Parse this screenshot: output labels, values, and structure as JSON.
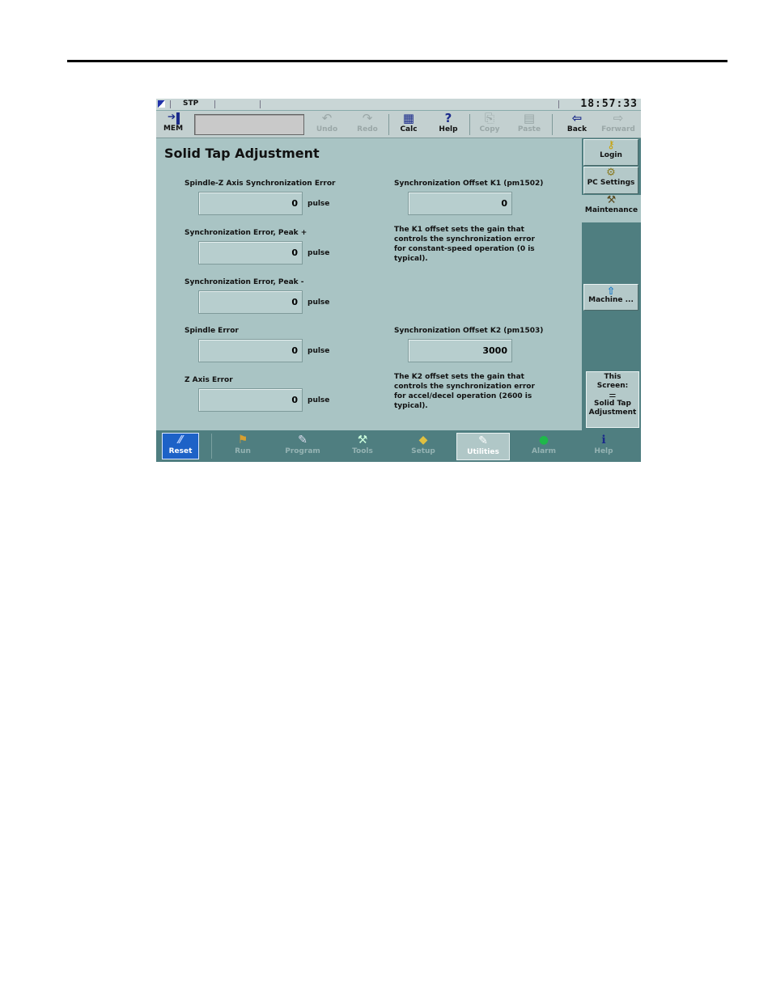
{
  "status": {
    "mode": "STP",
    "clock": "18:57:33"
  },
  "toolbar": {
    "mem_label": "MEM",
    "buttons": [
      {
        "label": "Undo",
        "icon": "undo-icon",
        "glyph": "↶"
      },
      {
        "label": "Redo",
        "icon": "redo-icon",
        "glyph": "↷"
      },
      {
        "label": "Calc",
        "icon": "calculator-icon",
        "glyph": "▦"
      },
      {
        "label": "Help",
        "icon": "help-pointer-icon",
        "glyph": "?"
      },
      {
        "label": "Copy",
        "icon": "copy-icon",
        "glyph": "⎘"
      },
      {
        "label": "Paste",
        "icon": "paste-icon",
        "glyph": "▤"
      },
      {
        "label": "Back",
        "icon": "back-arrow-icon",
        "glyph": "⇦"
      },
      {
        "label": "Forward",
        "icon": "forward-arrow-icon",
        "glyph": "⇨"
      }
    ]
  },
  "main": {
    "title": "Solid Tap Adjustment",
    "fields": [
      {
        "label": "Spindle-Z Axis Synchronization Error",
        "value": "0",
        "unit": "pulse"
      },
      {
        "label": "Synchronization Error, Peak +",
        "value": "0",
        "unit": "pulse"
      },
      {
        "label": "Synchronization Error, Peak -",
        "value": "0",
        "unit": "pulse"
      },
      {
        "label": "Spindle Error",
        "value": "0",
        "unit": "pulse"
      },
      {
        "label": "Z Axis Error",
        "value": "0",
        "unit": "pulse"
      }
    ],
    "offsets": [
      {
        "label": "Synchronization Offset K1 (pm1502)",
        "value": "0",
        "description": "The K1 offset sets the gain that controls the synchronization error for constant-speed operation (0 is typical)."
      },
      {
        "label": "Synchronization Offset K2 (pm1503)",
        "value": "3000",
        "description": "The K2 offset sets the gain that controls the synchronization error for accel/decel operation (2600 is typical)."
      }
    ]
  },
  "right_panel": {
    "login": "Login",
    "pc_settings": "PC Settings",
    "maintenance": "Maintenance",
    "machine": "Machine ...",
    "this_screen_line1": "This",
    "this_screen_line2": "Screen:",
    "this_screen_line3": "Solid Tap",
    "this_screen_line4": "Adjustment"
  },
  "nav": {
    "reset": "Reset",
    "items": [
      {
        "label": "Run",
        "icon": "run-icon",
        "glyph": "⚑"
      },
      {
        "label": "Program",
        "icon": "program-icon",
        "glyph": "✎"
      },
      {
        "label": "Tools",
        "icon": "tools-icon",
        "glyph": "⚒"
      },
      {
        "label": "Setup",
        "icon": "setup-icon",
        "glyph": "◆"
      },
      {
        "label": "Utilities",
        "icon": "wrench-icon",
        "glyph": "🔧"
      },
      {
        "label": "Alarm",
        "icon": "alarm-light-icon",
        "glyph": "●"
      },
      {
        "label": "Help",
        "icon": "info-icon",
        "glyph": "ℹ"
      }
    ],
    "active": "Utilities"
  },
  "colors": {
    "screen_bg": "#a9c4c4",
    "panel": "#4f7e80",
    "reset": "#1d62c7",
    "alarm_green": "#1fb84a",
    "help_blue": "#1a2a8a"
  }
}
